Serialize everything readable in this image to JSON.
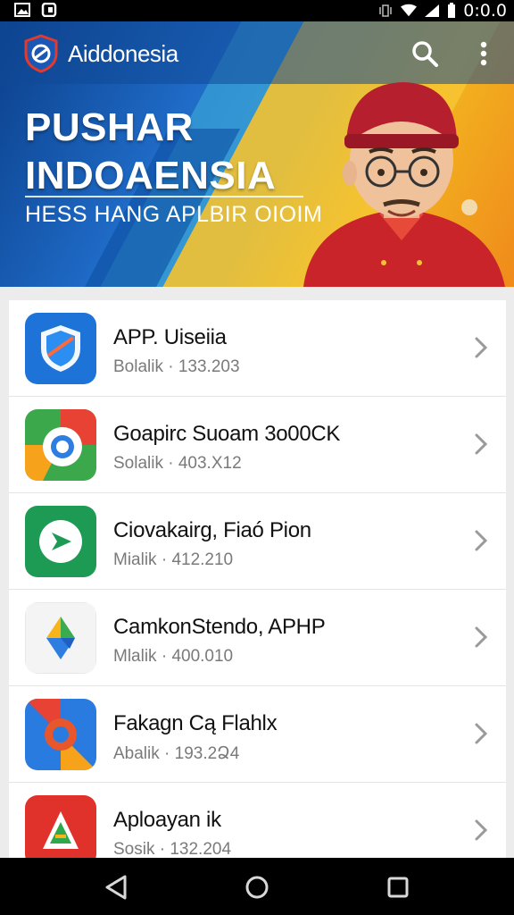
{
  "status_bar": {
    "time": "0:0.0",
    "left_icons": [
      "image-icon",
      "notification-icon"
    ],
    "right_icons": [
      "vibrate-icon",
      "wifi-icon",
      "signal-icon",
      "battery-icon"
    ]
  },
  "app_bar": {
    "title": "Aiddonesia",
    "logo_icon": "shield-logo-icon",
    "actions": [
      "search-icon",
      "more-vert-icon"
    ]
  },
  "hero": {
    "headline_line1": "PUSHAR",
    "headline_line2": "INDOAENSIA",
    "subline": "HESS HANG APLBIR OIOIM"
  },
  "apps": [
    {
      "title": "APP. Uiseiia",
      "subtitle": "Bolalik · 133.203",
      "icon": "blue-shield-app-icon"
    },
    {
      "title": "Goapirc Suoam 3o00CK",
      "subtitle": "Solalik · 403.X12",
      "icon": "colorful-chrome-app-icon"
    },
    {
      "title": "Ciovakairg, Fiaó Pion",
      "subtitle": "Mialik · 412.210",
      "icon": "green-play-app-icon"
    },
    {
      "title": "CamkonStendo, APHP",
      "subtitle": "Mlalik · 400.010",
      "icon": "drive-triangle-app-icon"
    },
    {
      "title": "Fakagn Cą Flahlx",
      "subtitle": "Abalik · 193.2Ձ4",
      "icon": "photos-swirl-app-icon"
    },
    {
      "title": "Aploayan ik",
      "subtitle": "Sosik · 132.204",
      "icon": "red-a-app-icon"
    }
  ],
  "nav_bar": {
    "buttons": [
      "back-icon",
      "home-icon",
      "recents-icon"
    ]
  },
  "colors": {
    "accent_blue": "#1f6bc7",
    "accent_yellow": "#f6c431",
    "status_bg": "#000000"
  }
}
